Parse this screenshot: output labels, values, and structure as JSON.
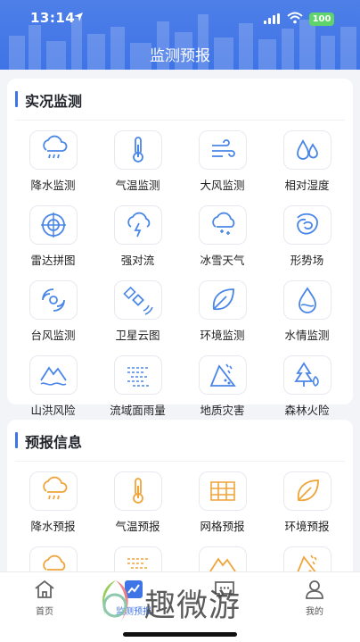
{
  "status_bar": {
    "time": "13:14",
    "battery": "100"
  },
  "page_title": "监测预报",
  "live_section": {
    "title": "实况监测",
    "items": [
      {
        "label": "降水监测",
        "icon": "rain-cloud-icon"
      },
      {
        "label": "气温监测",
        "icon": "thermometer-icon"
      },
      {
        "label": "大风监测",
        "icon": "wind-icon"
      },
      {
        "label": "相对湿度",
        "icon": "humidity-drops-icon"
      },
      {
        "label": "雷达拼图",
        "icon": "radar-icon"
      },
      {
        "label": "强对流",
        "icon": "thunderstorm-icon"
      },
      {
        "label": "冰雪天气",
        "icon": "snow-cloud-icon"
      },
      {
        "label": "形势场",
        "icon": "pressure-field-icon"
      },
      {
        "label": "台风监测",
        "icon": "typhoon-icon"
      },
      {
        "label": "卫星云图",
        "icon": "satellite-icon"
      },
      {
        "label": "环境监测",
        "icon": "leaf-icon"
      },
      {
        "label": "水情监测",
        "icon": "water-drop-icon"
      },
      {
        "label": "山洪风险",
        "icon": "flash-flood-icon"
      },
      {
        "label": "流域面雨量",
        "icon": "basin-rainfall-icon"
      },
      {
        "label": "地质灾害",
        "icon": "landslide-icon"
      },
      {
        "label": "森林火险",
        "icon": "forest-fire-icon"
      }
    ]
  },
  "forecast_section": {
    "title": "预报信息",
    "items": [
      {
        "label": "降水预报",
        "icon": "rain-cloud-icon"
      },
      {
        "label": "气温预报",
        "icon": "thermometer-icon"
      },
      {
        "label": "网格预报",
        "icon": "grid-map-icon"
      },
      {
        "label": "环境预报",
        "icon": "leaf-icon"
      },
      {
        "label": "",
        "icon": "cloud-forecast-icon"
      },
      {
        "label": "",
        "icon": "basin-rainfall-icon"
      },
      {
        "label": "",
        "icon": "flash-flood-icon"
      },
      {
        "label": "",
        "icon": "landslide-icon"
      }
    ]
  },
  "tabbar": {
    "items": [
      {
        "label": "首页",
        "icon": "home-icon"
      },
      {
        "label": "监测预报",
        "icon": "monitor-forecast-icon"
      },
      {
        "label": "",
        "icon": "message-icon"
      },
      {
        "label": "我的",
        "icon": "profile-icon"
      }
    ]
  },
  "watermark": {
    "text": "趣微游"
  },
  "colors": {
    "primary": "#3f74e6",
    "live_icon": "#4a86e8",
    "forecast_icon": "#f0a43a",
    "background": "#f2f4f8"
  }
}
